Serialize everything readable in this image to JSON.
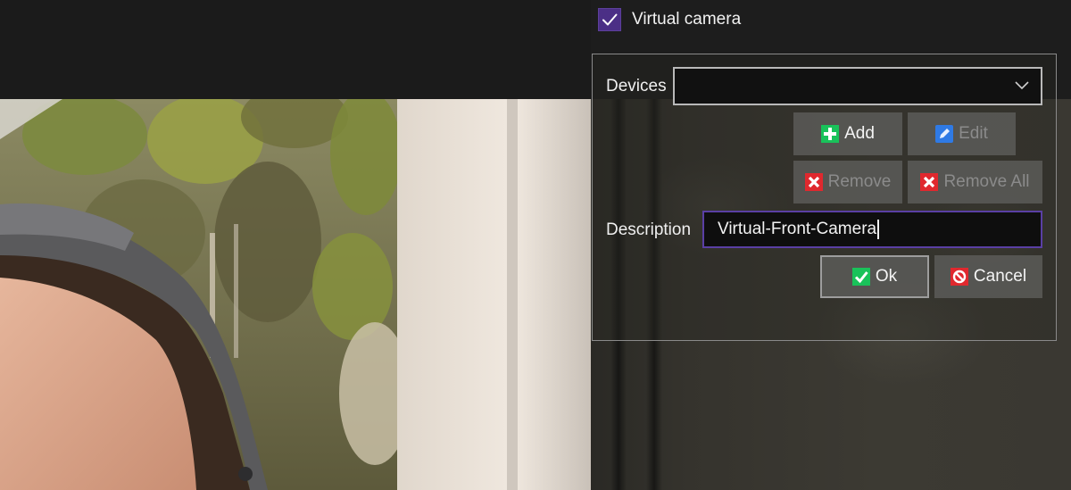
{
  "virtual_camera": {
    "label": "Virtual camera",
    "checked": true,
    "check_color": "#4b2f86"
  },
  "devices": {
    "label": "Devices",
    "selected": ""
  },
  "buttons": {
    "add": "Add",
    "edit": "Edit",
    "remove": "Remove",
    "remove_all": "Remove All",
    "ok": "Ok",
    "cancel": "Cancel"
  },
  "description": {
    "label": "Description",
    "value": "Virtual-Front-Camera"
  },
  "icons": {
    "add": "plus-icon",
    "edit": "pencil-icon",
    "remove": "remove-x-icon",
    "remove_all": "remove-x-icon",
    "ok": "check-icon",
    "cancel": "no-entry-icon",
    "combo": "chevron-down-icon"
  },
  "colors": {
    "accent": "#5a3fa4",
    "add_green": "#19c25a",
    "remove_red": "#e0282e",
    "edit_blue": "#2f7ae5"
  }
}
